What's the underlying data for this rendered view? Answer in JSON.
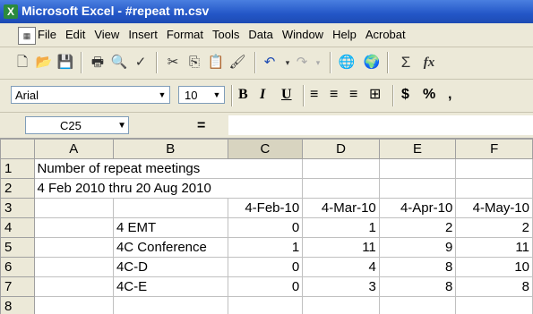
{
  "window": {
    "title": "Microsoft Excel - #repeat m.csv"
  },
  "menu": [
    "File",
    "Edit",
    "View",
    "Insert",
    "Format",
    "Tools",
    "Data",
    "Window",
    "Help",
    "Acrobat"
  ],
  "toolbar": {
    "font": "Arial",
    "size": "10",
    "bold": "B",
    "italic": "I",
    "underline": "U",
    "currency": "$",
    "percent": "%",
    "comma": ",",
    "sum": "Σ",
    "fx": "fx"
  },
  "formula": {
    "cell_ref": "C25",
    "equals": "="
  },
  "grid": {
    "columns": [
      "A",
      "B",
      "C",
      "D",
      "E",
      "F"
    ],
    "rows": [
      {
        "num": "1",
        "cells": [
          "Number of repeat meetings",
          "",
          "",
          "",
          "",
          ""
        ]
      },
      {
        "num": "2",
        "cells": [
          "4 Feb 2010 thru 20 Aug 2010",
          "",
          "",
          "",
          "",
          ""
        ]
      },
      {
        "num": "3",
        "cells": [
          "",
          "",
          "4-Feb-10",
          "4-Mar-10",
          "4-Apr-10",
          "4-May-10"
        ]
      },
      {
        "num": "4",
        "cells": [
          "",
          "4 EMT",
          "0",
          "1",
          "2",
          "2"
        ]
      },
      {
        "num": "5",
        "cells": [
          "",
          "4C Conference",
          "1",
          "11",
          "9",
          "11"
        ]
      },
      {
        "num": "6",
        "cells": [
          "",
          "4C-D",
          "0",
          "4",
          "8",
          "10"
        ]
      },
      {
        "num": "7",
        "cells": [
          "",
          "4C-E",
          "0",
          "3",
          "8",
          "8"
        ]
      },
      {
        "num": "8",
        "cells": [
          "",
          "",
          "",
          "",
          "",
          ""
        ]
      }
    ]
  }
}
